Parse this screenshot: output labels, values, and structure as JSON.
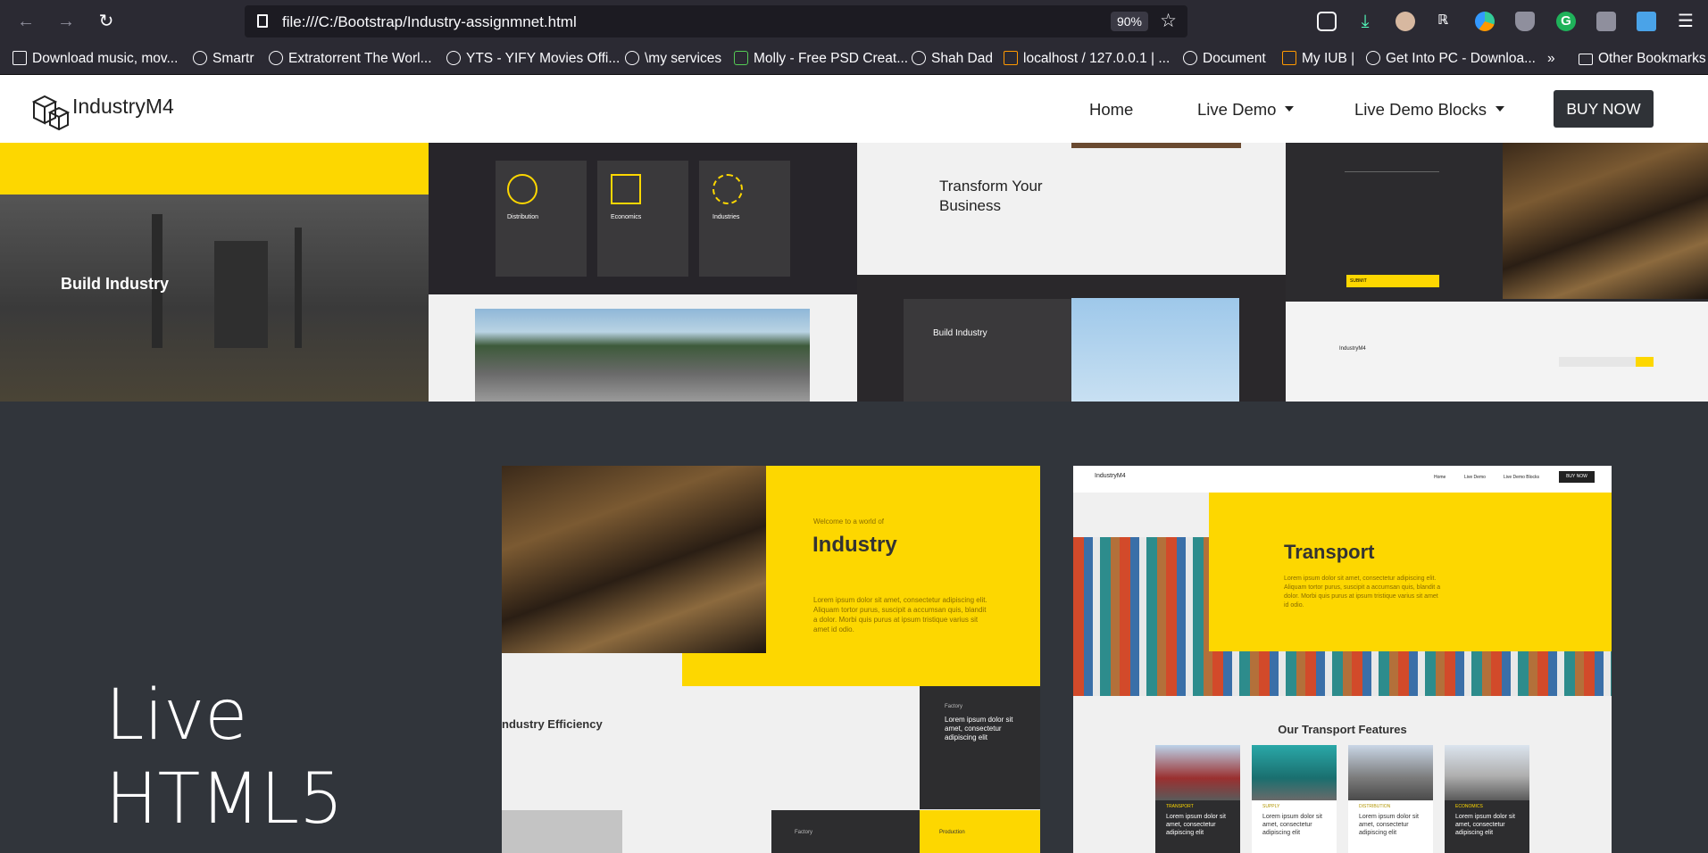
{
  "browser": {
    "url": "file:///C:/Bootstrap/Industry-assignmnet.html",
    "zoom": "90%",
    "bookmarks": [
      "Download music, mov...",
      "Smartr",
      "Extratorrent The Worl...",
      "YTS - YIFY Movies Offi...",
      "\\my services",
      "Molly - Free PSD Creat...",
      "Shah Dad",
      "localhost / 127.0.0.1 | ...",
      "Document",
      "My IUB |",
      "Get Into PC - Downloa...",
      "Other Bookmarks"
    ]
  },
  "site": {
    "logo": "IndustryM4",
    "nav": {
      "home": "Home",
      "live_demo": "Live Demo",
      "live_demo_blocks": "Live Demo Blocks",
      "buy": "BUY NOW"
    }
  },
  "strip": {
    "build_industry": "Build Industry",
    "cards": [
      "Distribution",
      "Economics",
      "Industries"
    ],
    "transform": "Transform Your Business",
    "build_industry_2": "Build Industry",
    "submit": "SUBMIT",
    "footer_logo": "IndustryM4"
  },
  "hero": {
    "line1": "Live",
    "line2": "HTML5",
    "left_shot": {
      "kicker": "Welcome to a world of",
      "title": "Industry",
      "body": "Lorem ipsum dolor sit amet, consectetur adipiscing elit. Aliquam tortor purus, suscipit a accumsan quis, blandit a dolor. Morbi quis purus at ipsum tristique varius sit amet id odio.",
      "section": "ndustry Efficiency",
      "factory_label": "Factory",
      "factory_text": "Lorem ipsum dolor sit amet, consectetur adipiscing elit",
      "factory2": "Factory",
      "production": "Production"
    },
    "right_shot": {
      "logo": "IndustryM4",
      "nav": [
        "Home",
        "Live Demo",
        "Live Demo Blocks",
        "BUY NOW"
      ],
      "title": "Transport",
      "body": "Lorem ipsum dolor sit amet, consectetur adipiscing elit. Aliquam tortor purus, suscipit a accumsan quis, blandit a dolor. Morbi quis purus at ipsum tristique varius sit amet id odio.",
      "features": "Our Transport Features",
      "cards": [
        "TRANSPORT",
        "SUPPLY",
        "DISTRIBUTION",
        "ECONOMICS"
      ],
      "card_text": "Lorem ipsum dolor sit amet, consectetur adipiscing elit"
    }
  }
}
